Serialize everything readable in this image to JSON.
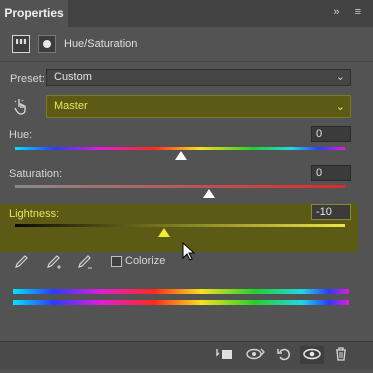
{
  "panel": {
    "tab_title": "Properties",
    "tab_icons": "» ≡"
  },
  "adjustment": {
    "title": "Hue/Saturation"
  },
  "preset": {
    "label": "Preset:",
    "value": "Custom"
  },
  "channel": {
    "value": "Master"
  },
  "hue": {
    "label": "Hue:",
    "value": "0"
  },
  "saturation": {
    "label": "Saturation:",
    "value": "0"
  },
  "lightness": {
    "label": "Lightness:",
    "value": "-10"
  },
  "colorize": {
    "label": "Colorize",
    "checked": false
  },
  "colors": {
    "highlight": "#5b5b16",
    "highlight_text": "#e8e55a",
    "panel_bg": "#535353"
  },
  "icons": {
    "hand": "☝",
    "eyedropper": "✒",
    "eyedropper_add": "✒+",
    "eyedropper_sub": "✒-",
    "clip": "⬒",
    "eye_prev": "◉",
    "reset": "↺",
    "eye": "👁",
    "trash": "🗑"
  }
}
